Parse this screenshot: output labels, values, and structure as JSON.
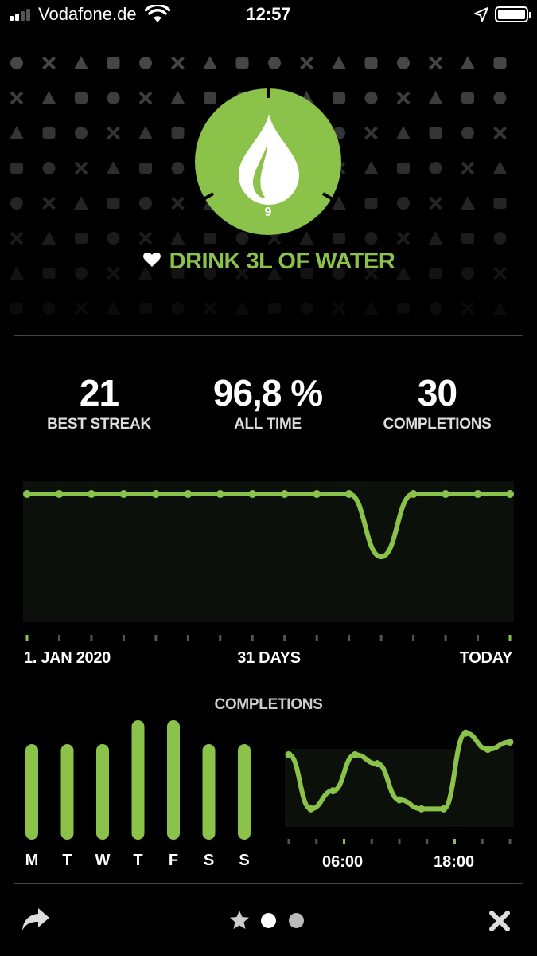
{
  "status_bar": {
    "carrier": "Vodafone.de",
    "time": "12:57",
    "icons": [
      "signal-icon",
      "wifi-icon",
      "location-icon",
      "battery-icon"
    ]
  },
  "habit": {
    "title": "DRINK 3L OF WATER",
    "icon": "water-drop-icon",
    "number": "9",
    "accent_color": "#8bc34a",
    "favorite_icon": "heart-icon"
  },
  "stats": [
    {
      "value": "21",
      "label": "BEST STREAK"
    },
    {
      "value": "96,8 %",
      "label": "ALL TIME"
    },
    {
      "value": "30",
      "label": "COMPLETIONS"
    }
  ],
  "trend": {
    "start_label": "1. JAN 2020",
    "middle_label": "31 DAYS",
    "end_label": "TODAY"
  },
  "completions": {
    "title": "COMPLETIONS",
    "hour_labels": [
      "06:00",
      "18:00"
    ]
  },
  "chart_data": [
    {
      "type": "line",
      "title": "",
      "xlabel": "",
      "ylabel": "",
      "x_labels": [
        "1. JAN 2020",
        "31 DAYS",
        "TODAY"
      ],
      "series": [
        {
          "values": [
            1,
            1,
            1,
            1,
            1,
            1,
            1,
            1,
            1,
            1,
            1,
            0,
            1,
            1,
            1,
            1
          ]
        }
      ],
      "ylim": [
        0,
        1
      ],
      "grid": false
    },
    {
      "type": "bar",
      "title": "COMPLETIONS",
      "categories": [
        "M",
        "T",
        "W",
        "T",
        "F",
        "S",
        "S"
      ],
      "values": [
        4,
        4,
        4,
        5,
        5,
        4,
        4
      ],
      "ylim": [
        0,
        5
      ]
    },
    {
      "type": "area",
      "title": "",
      "x_labels": [
        "06:00",
        "18:00"
      ],
      "series": [
        {
          "values": [
            4,
            1,
            2,
            4,
            3.5,
            1.5,
            1,
            1,
            5.2,
            4.3,
            4.7
          ]
        }
      ],
      "ylim": [
        0,
        6
      ]
    }
  ],
  "bottom_bar": {
    "share_icon": "share-icon",
    "star_icon": "star-icon",
    "close_icon": "close-icon",
    "pages": 2,
    "active_page": 1
  }
}
